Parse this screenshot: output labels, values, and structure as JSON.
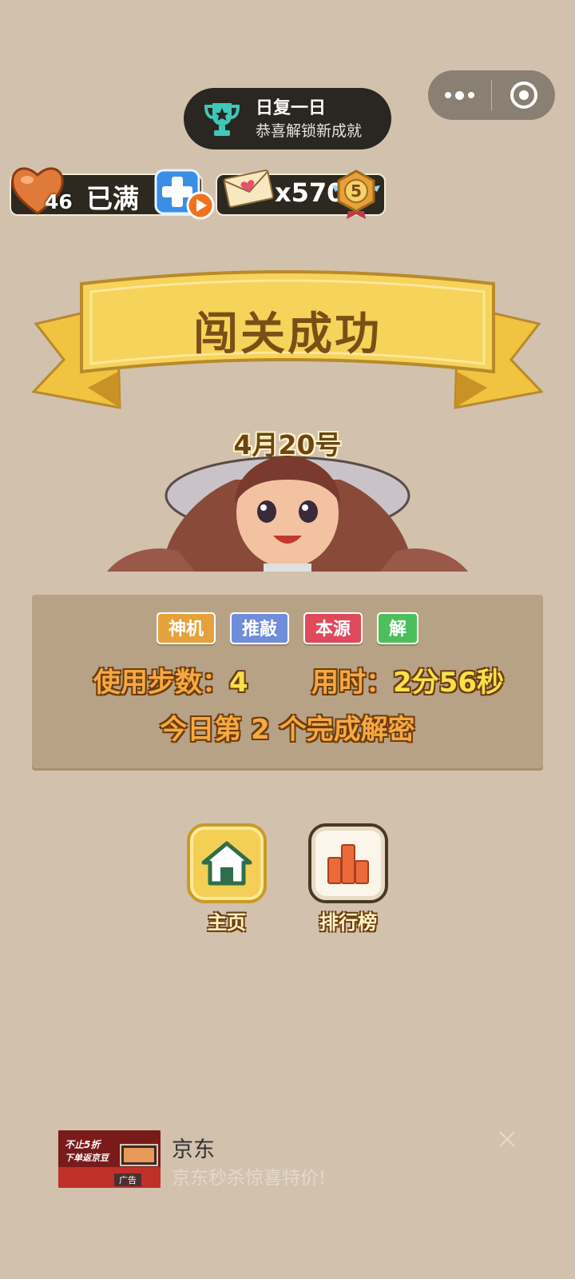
{
  "toast": {
    "title": "日复一日",
    "subtitle": "恭喜解锁新成就",
    "icon": "trophy-icon"
  },
  "status": {
    "lives_count": "46",
    "lives_status": "已满",
    "coins_count": "x570",
    "level": "5"
  },
  "banner": {
    "title": "闯关成功"
  },
  "date": "4月20号",
  "tags": [
    {
      "label": "神机",
      "color": "#e6a23a"
    },
    {
      "label": "推敲",
      "color": "#6f8dd9"
    },
    {
      "label": "本源",
      "color": "#e0495c"
    },
    {
      "label": "解",
      "color": "#4cbf5b"
    }
  ],
  "result": {
    "steps_label": "使用步数：",
    "steps_value": "4",
    "time_label": "用时：",
    "time_value": "2分56秒",
    "rank_text": "今日第 2 个完成解密"
  },
  "actions": {
    "home_label": "主页",
    "leaderboard_label": "排行榜"
  },
  "ad": {
    "brand": "京东",
    "description": "京东秒杀惊喜特价!",
    "thumb_text_1": "不止5折",
    "thumb_text_2": "下单返京豆",
    "thumb_tag": "广告"
  },
  "colors": {
    "background": "#d2c1ad",
    "panel": "#b8a286",
    "ribbon": "#f6d35a",
    "accent_text": "#f7e04a"
  }
}
